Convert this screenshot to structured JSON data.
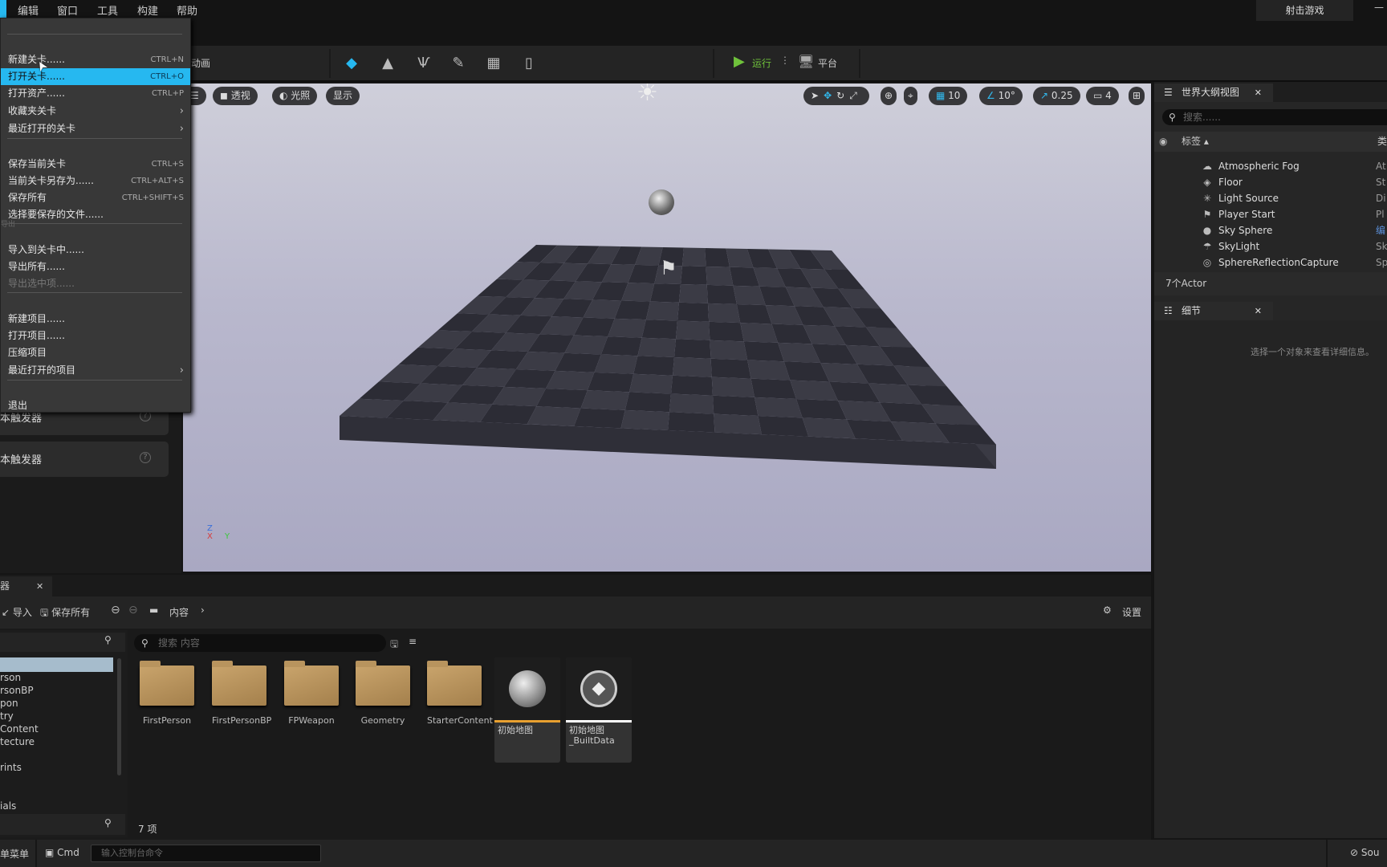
{
  "menubar": {
    "items": [
      "编辑",
      "窗口",
      "工具",
      "构建",
      "帮助"
    ],
    "project_tab": "射击游戏"
  },
  "toolbar": {
    "anim_label": "动画",
    "modes": [
      "select-mode-icon",
      "landscape-icon",
      "foliage-icon",
      "mesh-paint-icon",
      "fracture-icon",
      "brush-edit-icon"
    ],
    "play_label": "运行",
    "platform_label": "平台"
  },
  "file_menu": {
    "groups": [
      [
        {
          "label": "新建关卡......",
          "shortcut": "CTRL+N"
        },
        {
          "label": "打开关卡......",
          "shortcut": "CTRL+O",
          "highlighted": true
        },
        {
          "label": "打开资产......",
          "shortcut": "CTRL+P"
        },
        {
          "label": "收藏夹关卡",
          "submenu": true
        },
        {
          "label": "最近打开的关卡",
          "submenu": true
        }
      ],
      [
        {
          "label": "保存当前关卡",
          "shortcut": "CTRL+S"
        },
        {
          "label": "当前关卡另存为......",
          "shortcut": "CTRL+ALT+S"
        },
        {
          "label": "保存所有",
          "shortcut": "CTRL+SHIFT+S"
        },
        {
          "label": "选择要保存的文件......"
        }
      ],
      [
        {
          "label": "导入到关卡中......"
        },
        {
          "label": "导出所有......"
        },
        {
          "label": "导出选中项......",
          "disabled": true
        }
      ],
      [
        {
          "label": "新建项目......"
        },
        {
          "label": "打开项目......"
        },
        {
          "label": "压缩项目"
        },
        {
          "label": "最近打开的项目",
          "submenu": true
        }
      ],
      [
        {
          "label": "退出"
        }
      ]
    ],
    "section_label": "导出"
  },
  "left_panel": {
    "items": [
      "本触发器",
      "本触发器"
    ]
  },
  "viewport": {
    "perspective": "透视",
    "lit": "光照",
    "show": "显示",
    "grid_snap": "10",
    "rotation_snap": "10°",
    "scale_snap": "0.25",
    "camera_speed": "4",
    "axis": {
      "z": "Z",
      "x": "X",
      "y": "Y"
    }
  },
  "outliner": {
    "title": "世界大纲视图",
    "search_placeholder": "搜索......",
    "col_label": "标签",
    "col_type": "类",
    "rows": [
      {
        "name": "Atmospheric Fog",
        "type": "At",
        "icon": "fog-icon"
      },
      {
        "name": "Floor",
        "type": "St",
        "icon": "static-mesh-icon"
      },
      {
        "name": "Light Source",
        "type": "Di",
        "icon": "light-icon"
      },
      {
        "name": "Player Start",
        "type": "Pl",
        "icon": "player-start-icon"
      },
      {
        "name": "Sky Sphere",
        "type": "编",
        "icon": "sphere-icon"
      },
      {
        "name": "SkyLight",
        "type": "Sk",
        "icon": "skylight-icon"
      },
      {
        "name": "SphereReflectionCapture",
        "type": "Sp",
        "icon": "reflection-capture-icon"
      }
    ],
    "count": "7个Actor"
  },
  "details": {
    "title": "细节",
    "empty_text": "选择一个对象来查看详细信息。"
  },
  "content_browser": {
    "tab": "器",
    "import": "导入",
    "save_all": "保存所有",
    "path": "内容",
    "settings": "设置",
    "search_placeholder": "搜索 内容",
    "tree": [
      "rson",
      "rsonBP",
      "pon",
      "try",
      "Content",
      "tecture",
      "rints",
      "ials"
    ],
    "folders": [
      "FirstPerson",
      "FirstPersonBP",
      "FPWeapon",
      "Geometry",
      "StarterContent"
    ],
    "maps": [
      {
        "name": "初始地图",
        "accent": "#e8a030"
      },
      {
        "name": "初始地图_BuiltData",
        "accent": "#ffffff"
      }
    ],
    "count": "7 项"
  },
  "statusbar": {
    "menu": "单菜单",
    "cmd": "Cmd",
    "console_placeholder": "输入控制台命令",
    "source": "Sou"
  },
  "colors": {
    "accent": "#26b8f0",
    "play": "#6fc23b"
  }
}
